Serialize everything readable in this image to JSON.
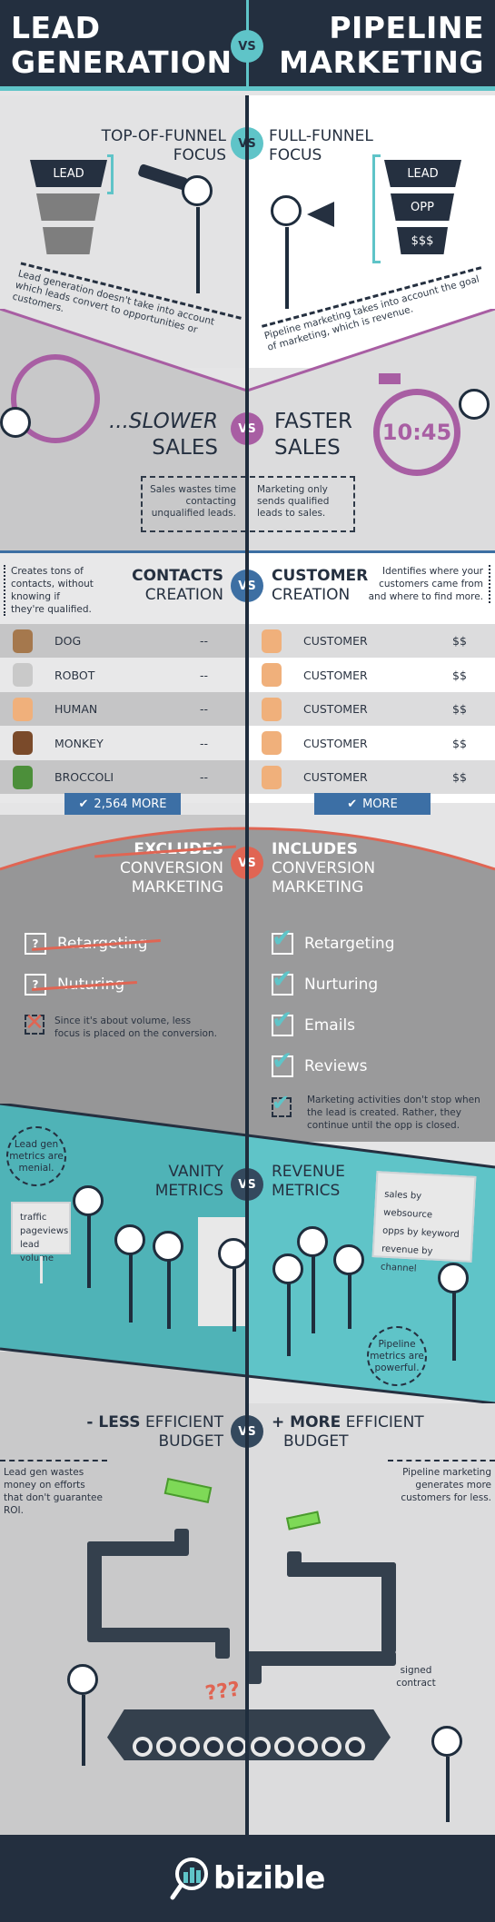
{
  "header": {
    "left_title_line1": "LEAD",
    "left_title_line2": "GENERATION",
    "right_title_line1": "PIPELINE",
    "right_title_line2": "MARKETING",
    "vs": "VS"
  },
  "funnel_focus": {
    "left_title_line1": "TOP-OF-FUNNEL",
    "left_title_line2": "FOCUS",
    "right_title_line1": "FULL-FUNNEL",
    "right_title_line2": "FOCUS",
    "vs": "VS",
    "left_funnel": [
      "LEAD",
      "",
      ""
    ],
    "right_funnel": [
      "LEAD",
      "OPP",
      "$$$"
    ],
    "left_note": "Lead generation doesn't take into account which leads convert to opportunities or customers.",
    "right_note": "Pipeline marketing takes into account the goal of marketing, which is revenue."
  },
  "sales_speed": {
    "left_title_line1": "...SLOWER",
    "left_title_line2": "SALES",
    "right_title_line1": "FASTER",
    "right_title_line2": "SALES",
    "vs": "VS",
    "stopwatch_time": "10:45",
    "left_note": "Sales wastes time contacting unqualified leads.",
    "right_note": "Marketing only sends qualified leads to sales.",
    "accent_color": "#a85ea3"
  },
  "creation": {
    "left_title_line1": "CONTACTS",
    "left_title_line2": "CREATION",
    "right_title_line1": "CUSTOMER",
    "right_title_line2": "CREATION",
    "vs": "VS",
    "left_note": "Creates tons of contacts, without knowing if they're qualified.",
    "right_note": "Identifies where your customers came from and where to find more.",
    "left_rows": [
      {
        "icon": "dog-icon",
        "label": "DOG",
        "value": "--"
      },
      {
        "icon": "robot-icon",
        "label": "ROBOT",
        "value": "--"
      },
      {
        "icon": "human-icon",
        "label": "HUMAN",
        "value": "--"
      },
      {
        "icon": "monkey-icon",
        "label": "MONKEY",
        "value": "--"
      },
      {
        "icon": "broccoli-icon",
        "label": "BROCCOLI",
        "value": "--"
      }
    ],
    "right_rows": [
      {
        "icon": "customer-icon",
        "label": "CUSTOMER",
        "value": "$$"
      },
      {
        "icon": "customer-icon",
        "label": "CUSTOMER",
        "value": "$$"
      },
      {
        "icon": "customer-icon",
        "label": "CUSTOMER",
        "value": "$$"
      },
      {
        "icon": "customer-icon",
        "label": "CUSTOMER",
        "value": "$$"
      },
      {
        "icon": "customer-icon",
        "label": "CUSTOMER",
        "value": "$$"
      }
    ],
    "left_more": "2,564 MORE",
    "right_more": "MORE",
    "button_color": "#3c6fa5"
  },
  "conversion": {
    "left_title_line1": "EXCLUDES",
    "left_title_line2": "CONVERSION",
    "left_title_line3": "MARKETING",
    "right_title_line1": "INCLUDES",
    "right_title_line2": "CONVERSION",
    "right_title_line3": "MARKETING",
    "vs": "VS",
    "left_items": [
      "Retargeting",
      "Nuturing"
    ],
    "left_box_glyph": "?",
    "left_note": "Since it's about volume, less focus is placed on the conversion.",
    "right_items": [
      "Retargeting",
      "Nurturing",
      "Emails",
      "Reviews"
    ],
    "right_note": "Marketing activities don't stop when the lead is created. Rather, they continue until the opp is closed.",
    "accent_color": "#e06553"
  },
  "metrics": {
    "left_title_line1": "VANITY",
    "left_title_line2": "METRICS",
    "right_title_line1": "REVENUE",
    "right_title_line2": "METRICS",
    "vs": "VS",
    "left_circle_note": "Lead gen metrics are menial.",
    "right_circle_note": "Pipeline metrics are powerful.",
    "left_board": [
      "traffic",
      "pageviews",
      "lead volume"
    ],
    "right_board": [
      "sales by websource",
      "opps by keyword",
      "revenue by channel"
    ],
    "accent_color": "#5fc4c8"
  },
  "budget": {
    "left_title_prefix": "- LESS",
    "left_title_suffix": "EFFICIENT",
    "left_title_line2": "BUDGET",
    "right_title_prefix": "+ MORE",
    "right_title_suffix": "EFFICIENT",
    "right_title_line2": "BUDGET",
    "vs": "VS",
    "left_note": "Lead gen wastes money on efforts that don't guarantee ROI.",
    "right_note": "Pipeline marketing generates more customers for less.",
    "question_marks": "???",
    "contract_label": "signed contract"
  },
  "footer": {
    "brand": "bizible"
  }
}
